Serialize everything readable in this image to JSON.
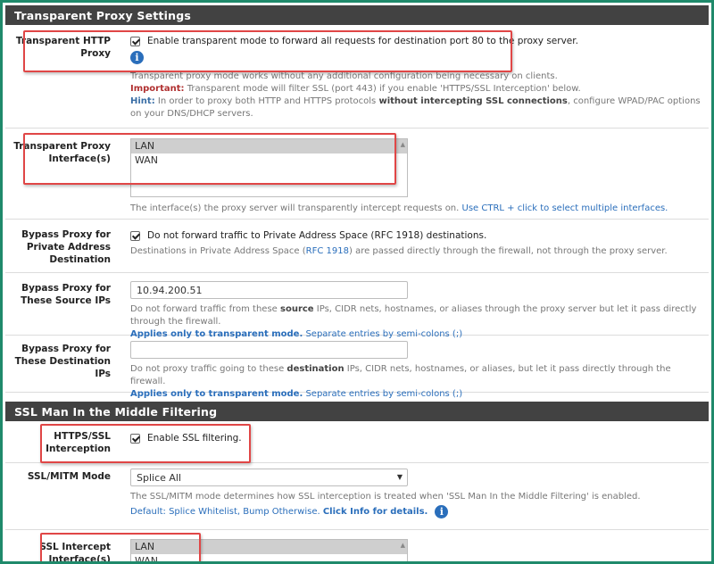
{
  "transparent_section": {
    "title": "Transparent Proxy Settings",
    "http_proxy": {
      "label": "Transparent HTTP Proxy",
      "checkbox_text": "Enable transparent mode to forward all requests for destination port 80 to the proxy server.",
      "help_line1": "Transparent proxy mode works without any additional configuration being necessary on clients.",
      "important_label": "Important:",
      "important_text": "Transparent mode will filter SSL (port 443) if you enable 'HTTPS/SSL Interception' below.",
      "hint_label": "Hint:",
      "hint_text_a": "In order to proxy both HTTP and HTTPS protocols",
      "hint_text_bold": "without intercepting SSL connections",
      "hint_text_b": ", configure WPAD/PAC options on your DNS/DHCP servers."
    },
    "proxy_interface": {
      "label": "Transparent Proxy Interface(s)",
      "options": [
        "LAN",
        "WAN"
      ],
      "help_a": "The interface(s) the proxy server will transparently intercept requests on.",
      "help_link": "Use CTRL + click to select multiple interfaces."
    },
    "bypass_private": {
      "label": "Bypass Proxy for Private Address Destination",
      "checkbox_text": "Do not forward traffic to Private Address Space (RFC 1918) destinations.",
      "help_a": "Destinations in Private Address Space (",
      "help_link": "RFC 1918",
      "help_b": ") are passed directly through the firewall, not through the proxy server."
    },
    "bypass_source": {
      "label": "Bypass Proxy for These Source IPs",
      "value": "10.94.200.51",
      "help_a": "Do not forward traffic from these",
      "help_bold": "source",
      "help_b": "IPs, CIDR nets, hostnames, or aliases through the proxy server but let it pass directly through the firewall.",
      "applies": "Applies only to transparent mode.",
      "separate": "Separate entries by semi-colons (;)"
    },
    "bypass_dest": {
      "label": "Bypass Proxy for These Destination IPs",
      "value": "",
      "help_a": "Do not proxy traffic going to these",
      "help_bold": "destination",
      "help_b": "IPs, CIDR nets, hostnames, or aliases, but let it pass directly through the firewall.",
      "applies": "Applies only to transparent mode.",
      "separate": "Separate entries by semi-colons (;)"
    }
  },
  "ssl_section": {
    "title": "SSL Man In the Middle Filtering",
    "https_interception": {
      "label": "HTTPS/SSL Interception",
      "checkbox_text": "Enable SSL filtering."
    },
    "mitm_mode": {
      "label": "SSL/MITM Mode",
      "selected": "Splice All",
      "help_line1": "The SSL/MITM mode determines how SSL interception is treated when 'SSL Man In the Middle Filtering' is enabled.",
      "default_text": "Default: Splice Whitelist, Bump Otherwise.",
      "click_info": "Click Info for details."
    },
    "intercept_interface": {
      "label": "SSL Intercept Interface(s)",
      "options": [
        "LAN",
        "WAN"
      ]
    }
  },
  "colors": {
    "header_bg": "#424242",
    "highlight_box": "#e04646",
    "frame_border": "#1f8a6b",
    "link": "#2a6ebb"
  },
  "icons": {
    "info": "i"
  }
}
